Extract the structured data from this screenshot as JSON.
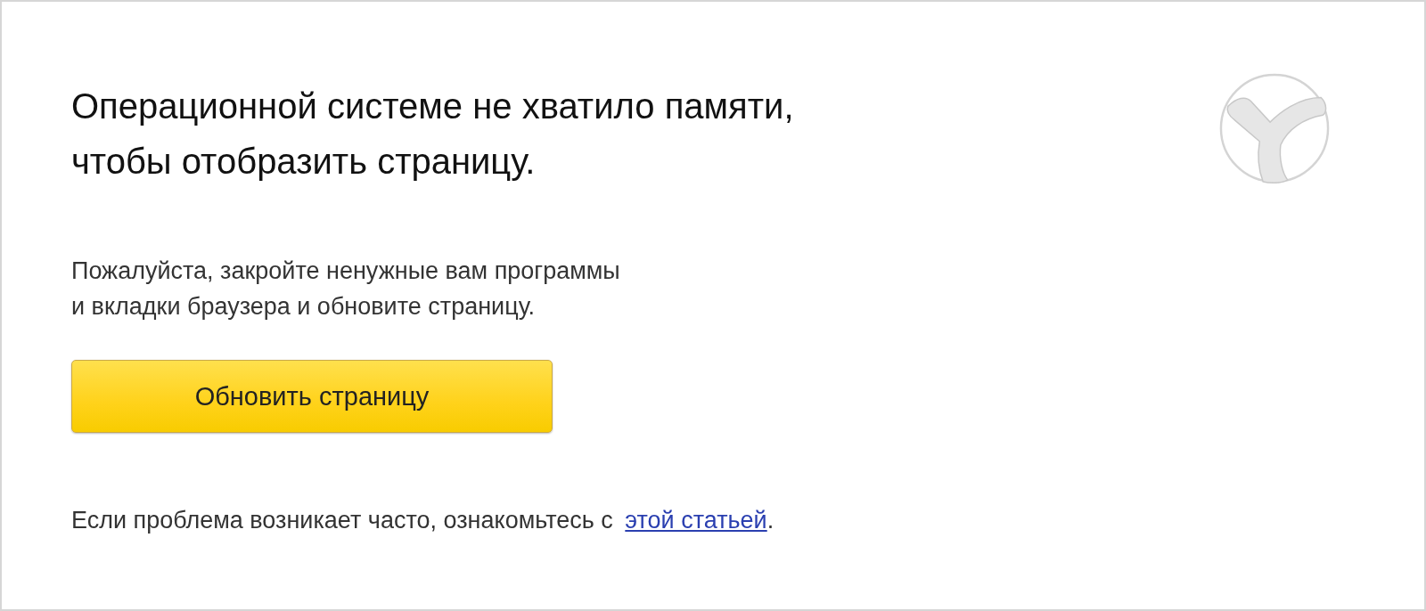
{
  "heading": "Операционной системе не хватило памяти,\nчтобы отобразить страницу.",
  "message": "Пожалуйста, закройте ненужные вам программы\nи вкладки браузера и обновите страницу.",
  "button": {
    "label": "Обновить страницу"
  },
  "footer": {
    "text": "Если проблема возникает часто, ознакомьтесь с",
    "link": "этой статьей",
    "after": "."
  }
}
